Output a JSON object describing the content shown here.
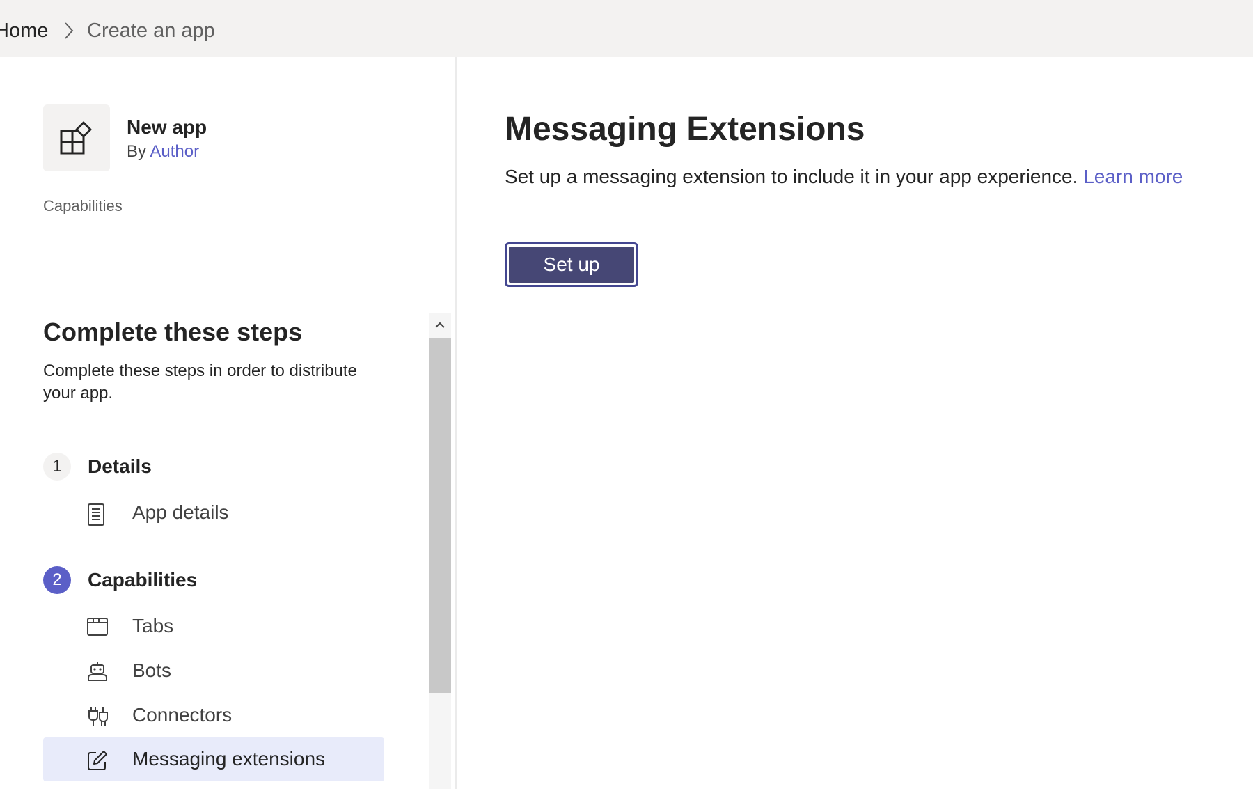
{
  "breadcrumb": {
    "home": "Home",
    "current": "Create an app"
  },
  "app": {
    "name": "New app",
    "by_prefix": "By",
    "author": "Author",
    "section_label": "Capabilities"
  },
  "steps": {
    "title": "Complete these steps",
    "description": "Complete these steps in order to distribute your app.",
    "groups": [
      {
        "number": "1",
        "title": "Details",
        "items": [
          {
            "label": "App details",
            "icon": "document-icon"
          }
        ]
      },
      {
        "number": "2",
        "title": "Capabilities",
        "items": [
          {
            "label": "Tabs",
            "icon": "tab-icon"
          },
          {
            "label": "Bots",
            "icon": "bot-icon"
          },
          {
            "label": "Connectors",
            "icon": "connector-icon"
          },
          {
            "label": "Messaging extensions",
            "icon": "edit-icon",
            "selected": true
          }
        ]
      }
    ]
  },
  "main": {
    "title": "Messaging Extensions",
    "description": "Set up a messaging extension to include it in your app experience.",
    "learn_more": "Learn more",
    "setup_button": "Set up"
  },
  "colors": {
    "brand": "#5b5fc7",
    "button": "#464775",
    "selected_bg": "#e8ebfa"
  }
}
